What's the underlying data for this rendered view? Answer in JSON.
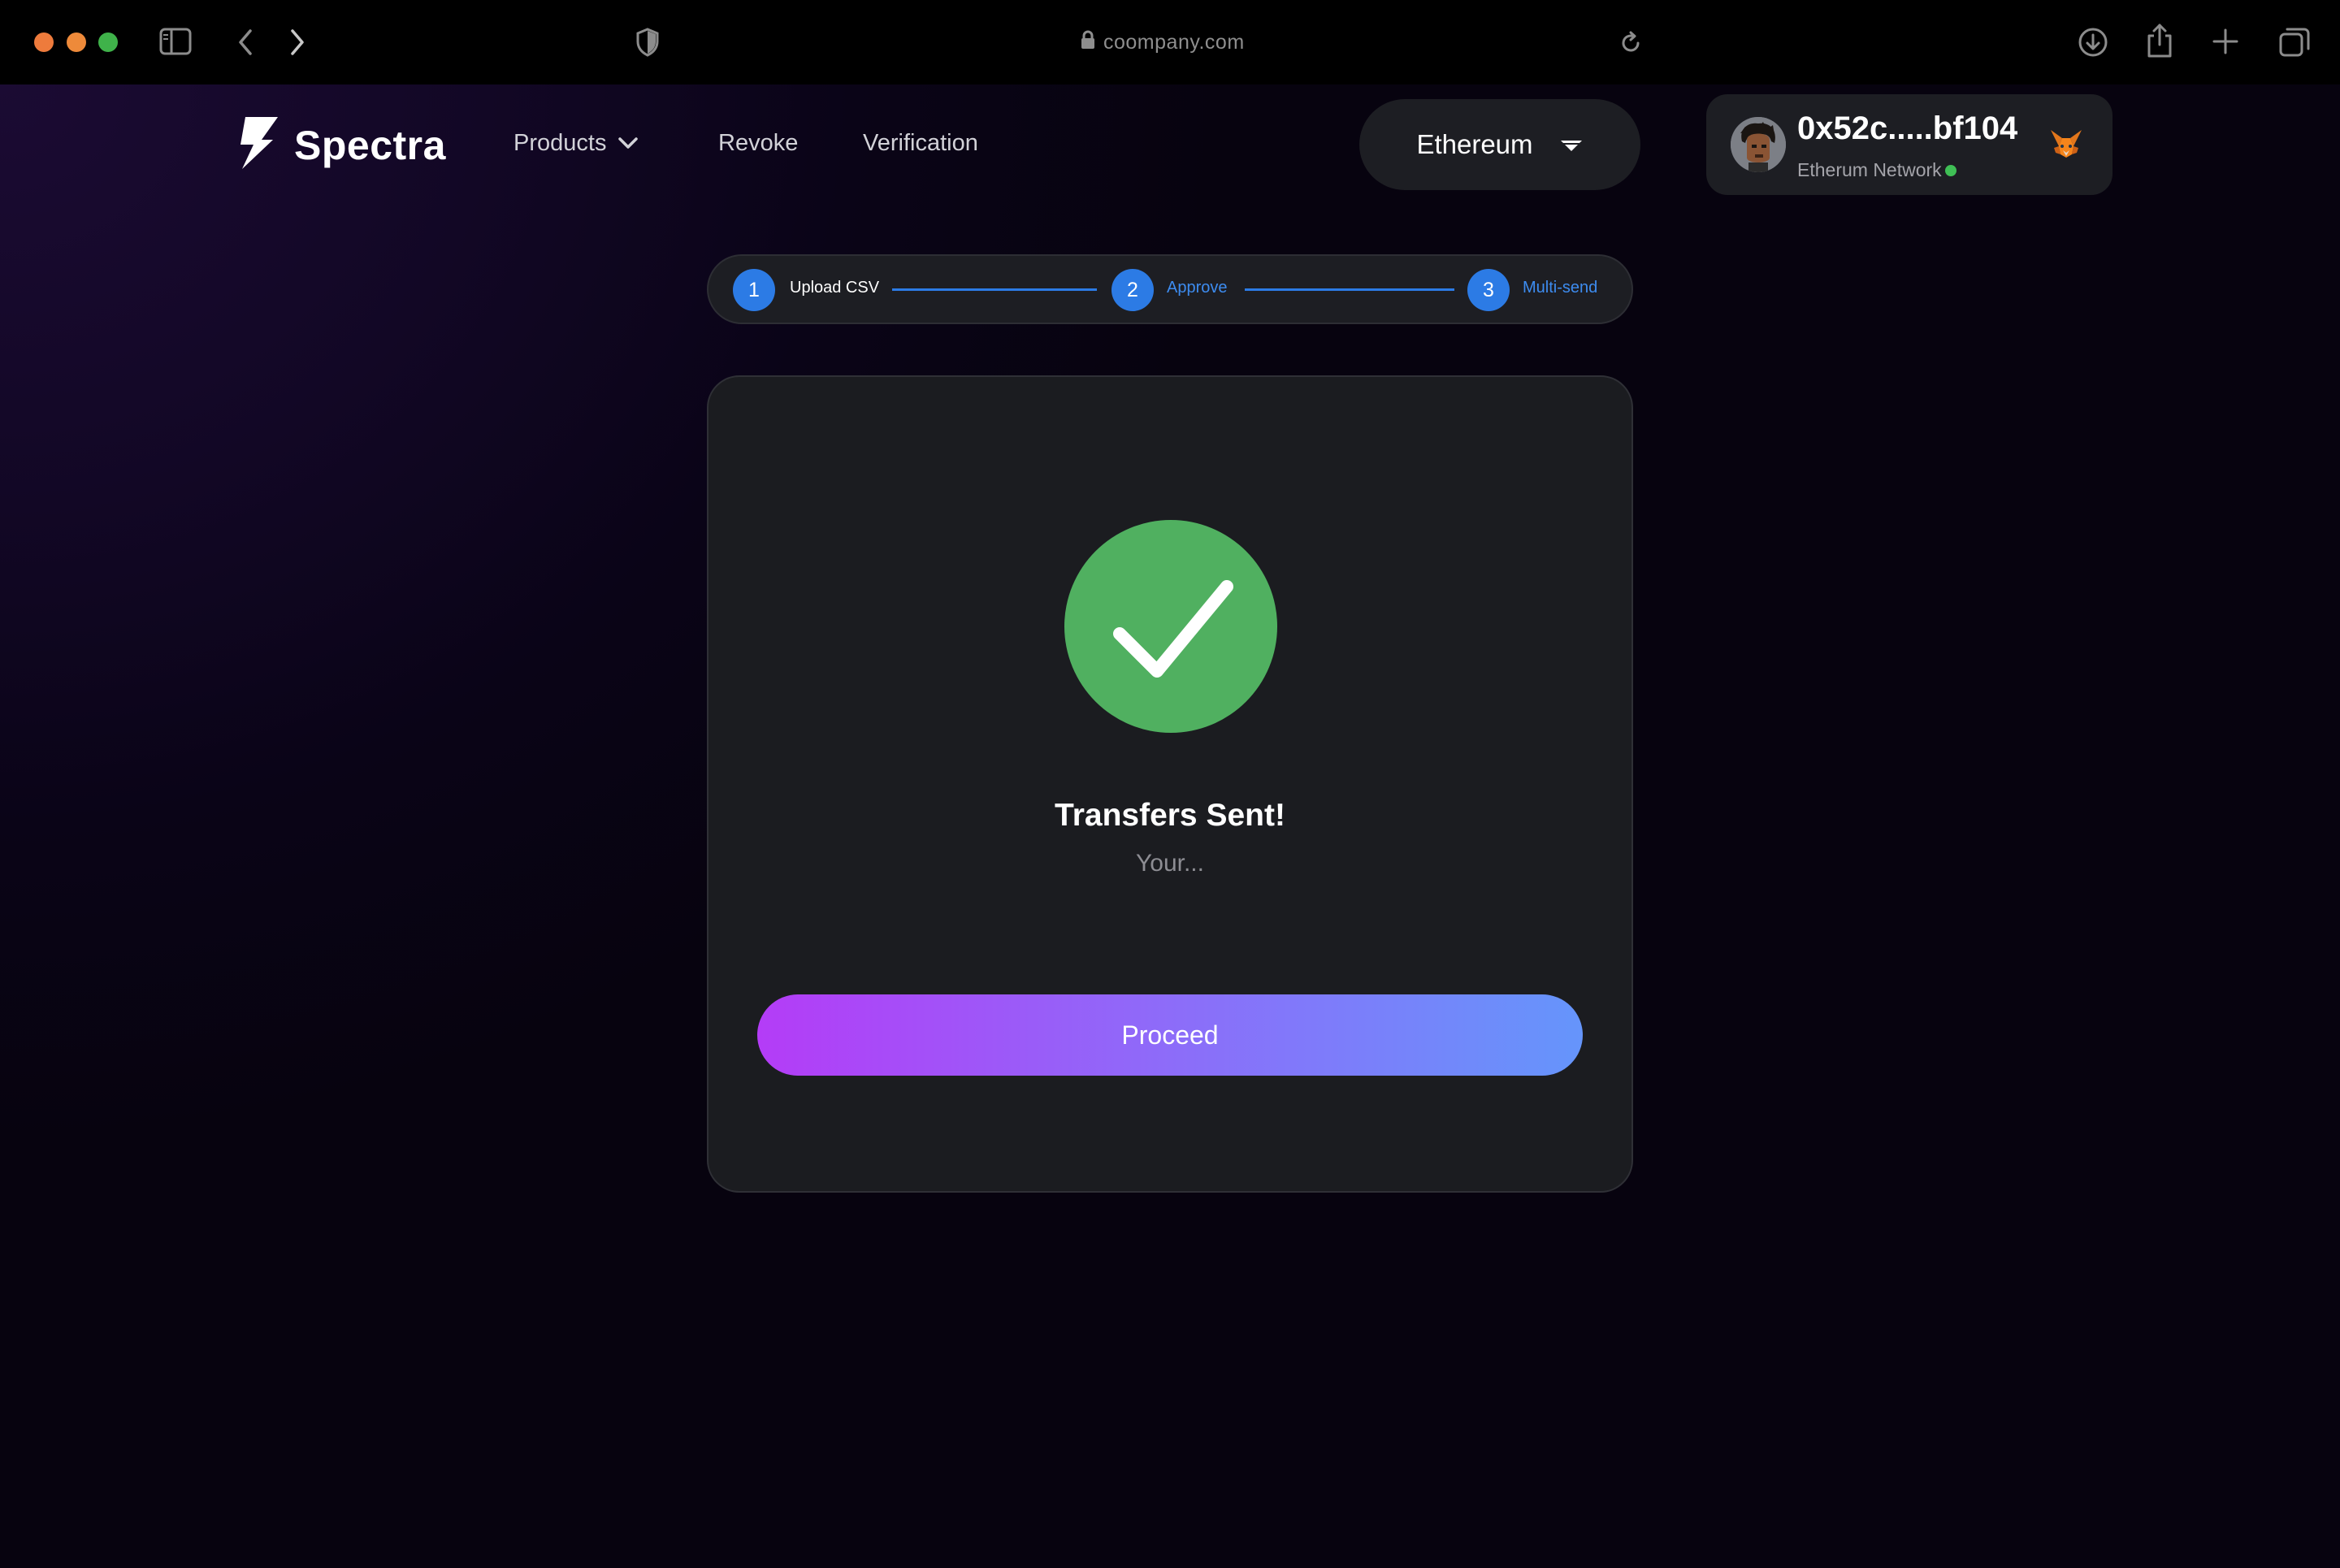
{
  "browser": {
    "url": "coompany.com"
  },
  "nav": {
    "brand": "Spectra",
    "products_label": "Products",
    "revoke_label": "Revoke",
    "verification_label": "Verification",
    "network_select": "Ethereum"
  },
  "wallet": {
    "address": "0x52c.....bf104",
    "network": "Etherum Network",
    "status_color": "#3fbf55"
  },
  "stepper": {
    "steps": [
      {
        "number": "1",
        "label": "Upload CSV",
        "state": "done"
      },
      {
        "number": "2",
        "label": "Approve",
        "state": "active"
      },
      {
        "number": "3",
        "label": "Multi-send",
        "state": "active"
      }
    ],
    "accent": "#2c7be5"
  },
  "result": {
    "icon": "check-icon",
    "title": "Transfers Sent!",
    "subtitle": "Your...",
    "button_label": "Proceed"
  }
}
